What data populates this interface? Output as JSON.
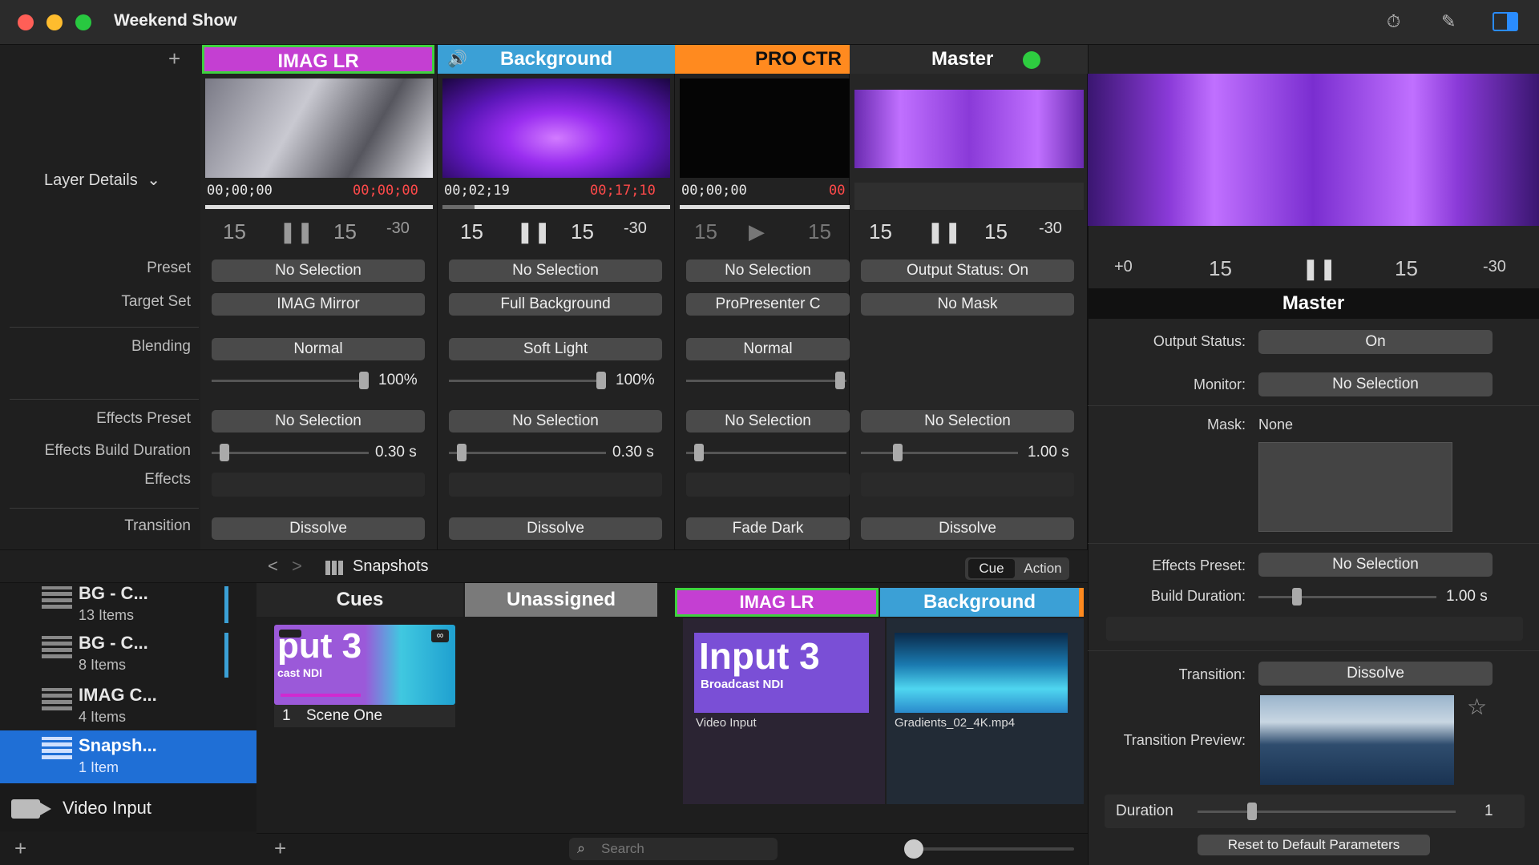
{
  "window": {
    "title": "Weekend Show"
  },
  "colors": {
    "imag_accent": "#c43fd2",
    "imag_border": "#3fd13f",
    "bg_accent": "#3ba0d6",
    "pro_accent": "#ff8a1f",
    "selection_blue": "#1f6fd6",
    "green_dot": "#2ecc40"
  },
  "layer_header": {
    "add_glyph": "+",
    "details_label": "Layer Details",
    "chevron": "⌄"
  },
  "row_labels": {
    "preset": "Preset",
    "target_set": "Target Set",
    "blending": "Blending",
    "effects_preset": "Effects Preset",
    "effects_build_duration": "Effects Build Duration",
    "effects": "Effects",
    "transition": "Transition"
  },
  "transport": {
    "back15": "15",
    "fwd15": "15",
    "skip": "-30",
    "pause": "❚❚",
    "play": "▶",
    "plus0": "+0"
  },
  "layers": [
    {
      "name": "IMAG LR",
      "time_left": "00;00;00",
      "time_right": "00;00;00",
      "progress": 0.0,
      "state": "pause",
      "preset": "No Selection",
      "target_set": "IMAG Mirror",
      "blending": "Normal",
      "opacity": "100%",
      "opacity_level": 1.0,
      "effects_preset": "No Selection",
      "build_duration": "0.30 s",
      "build_level": 0.05,
      "transition": "Dissolve"
    },
    {
      "name": "Background",
      "time_left": "00;02;19",
      "time_right": "00;17;10",
      "progress": 0.14,
      "state": "pause",
      "preset": "No Selection",
      "target_set": "Full Background",
      "blending": "Soft Light",
      "opacity": "100%",
      "opacity_level": 1.0,
      "effects_preset": "No Selection",
      "build_duration": "0.30 s",
      "build_level": 0.05,
      "transition": "Dissolve"
    },
    {
      "name": "PRO CTR",
      "time_left": "00;00;00",
      "time_right": "00",
      "progress": 0.0,
      "state": "play",
      "preset": "No Selection",
      "target_set": "ProPresenter C",
      "blending": "Normal",
      "opacity": "",
      "opacity_level": 1.0,
      "effects_preset": "No Selection",
      "build_duration": "",
      "build_level": 0.05,
      "transition": "Fade Dark"
    },
    {
      "name": "Master",
      "preset": "Output Status: On",
      "target_set": "No Mask",
      "effects_preset": "No Selection",
      "build_duration": "1.00 s",
      "build_level": 0.2,
      "transition": "Dissolve"
    }
  ],
  "sidebar": {
    "items": [
      {
        "title": "BG - C...",
        "sub": "13 Items"
      },
      {
        "title": "BG - C...",
        "sub": "8 Items"
      },
      {
        "title": "IMAG C...",
        "sub": "4 Items"
      },
      {
        "title": "Snapsh...",
        "sub": "1 Item"
      }
    ],
    "video_input": "Video Input",
    "add": "+"
  },
  "cues_area": {
    "breadcrumb": "Snapshots",
    "nav_back": "<",
    "nav_fwd": ">",
    "seg_cue": "Cue",
    "seg_action": "Action",
    "tabs": [
      "Cues",
      "Unassigned",
      "IMAG LR",
      "Background"
    ],
    "cue_card": {
      "num": "1",
      "name": "Scene One",
      "thumb_big": "put 3",
      "thumb_small": "cast NDI"
    },
    "media": [
      {
        "big": "Input 3",
        "small": "Broadcast NDI",
        "caption": "Video Input"
      },
      {
        "caption": "Gradients_02_4K.mp4"
      }
    ],
    "search_placeholder": "Search",
    "add": "+"
  },
  "right_panel": {
    "title": "Master",
    "output_status_label": "Output Status:",
    "output_status": "On",
    "monitor_label": "Monitor:",
    "monitor": "No Selection",
    "mask_label": "Mask:",
    "mask": "None",
    "effects_preset_label": "Effects Preset:",
    "effects_preset": "No Selection",
    "build_duration_label": "Build Duration:",
    "build_duration": "1.00 s",
    "build_level": 0.2,
    "transition_label": "Transition:",
    "transition": "Dissolve",
    "transition_preview_label": "Transition Preview:",
    "duration_label": "Duration",
    "duration": "1",
    "duration_level": 0.15,
    "reset": "Reset to Default Parameters",
    "star": "☆"
  }
}
